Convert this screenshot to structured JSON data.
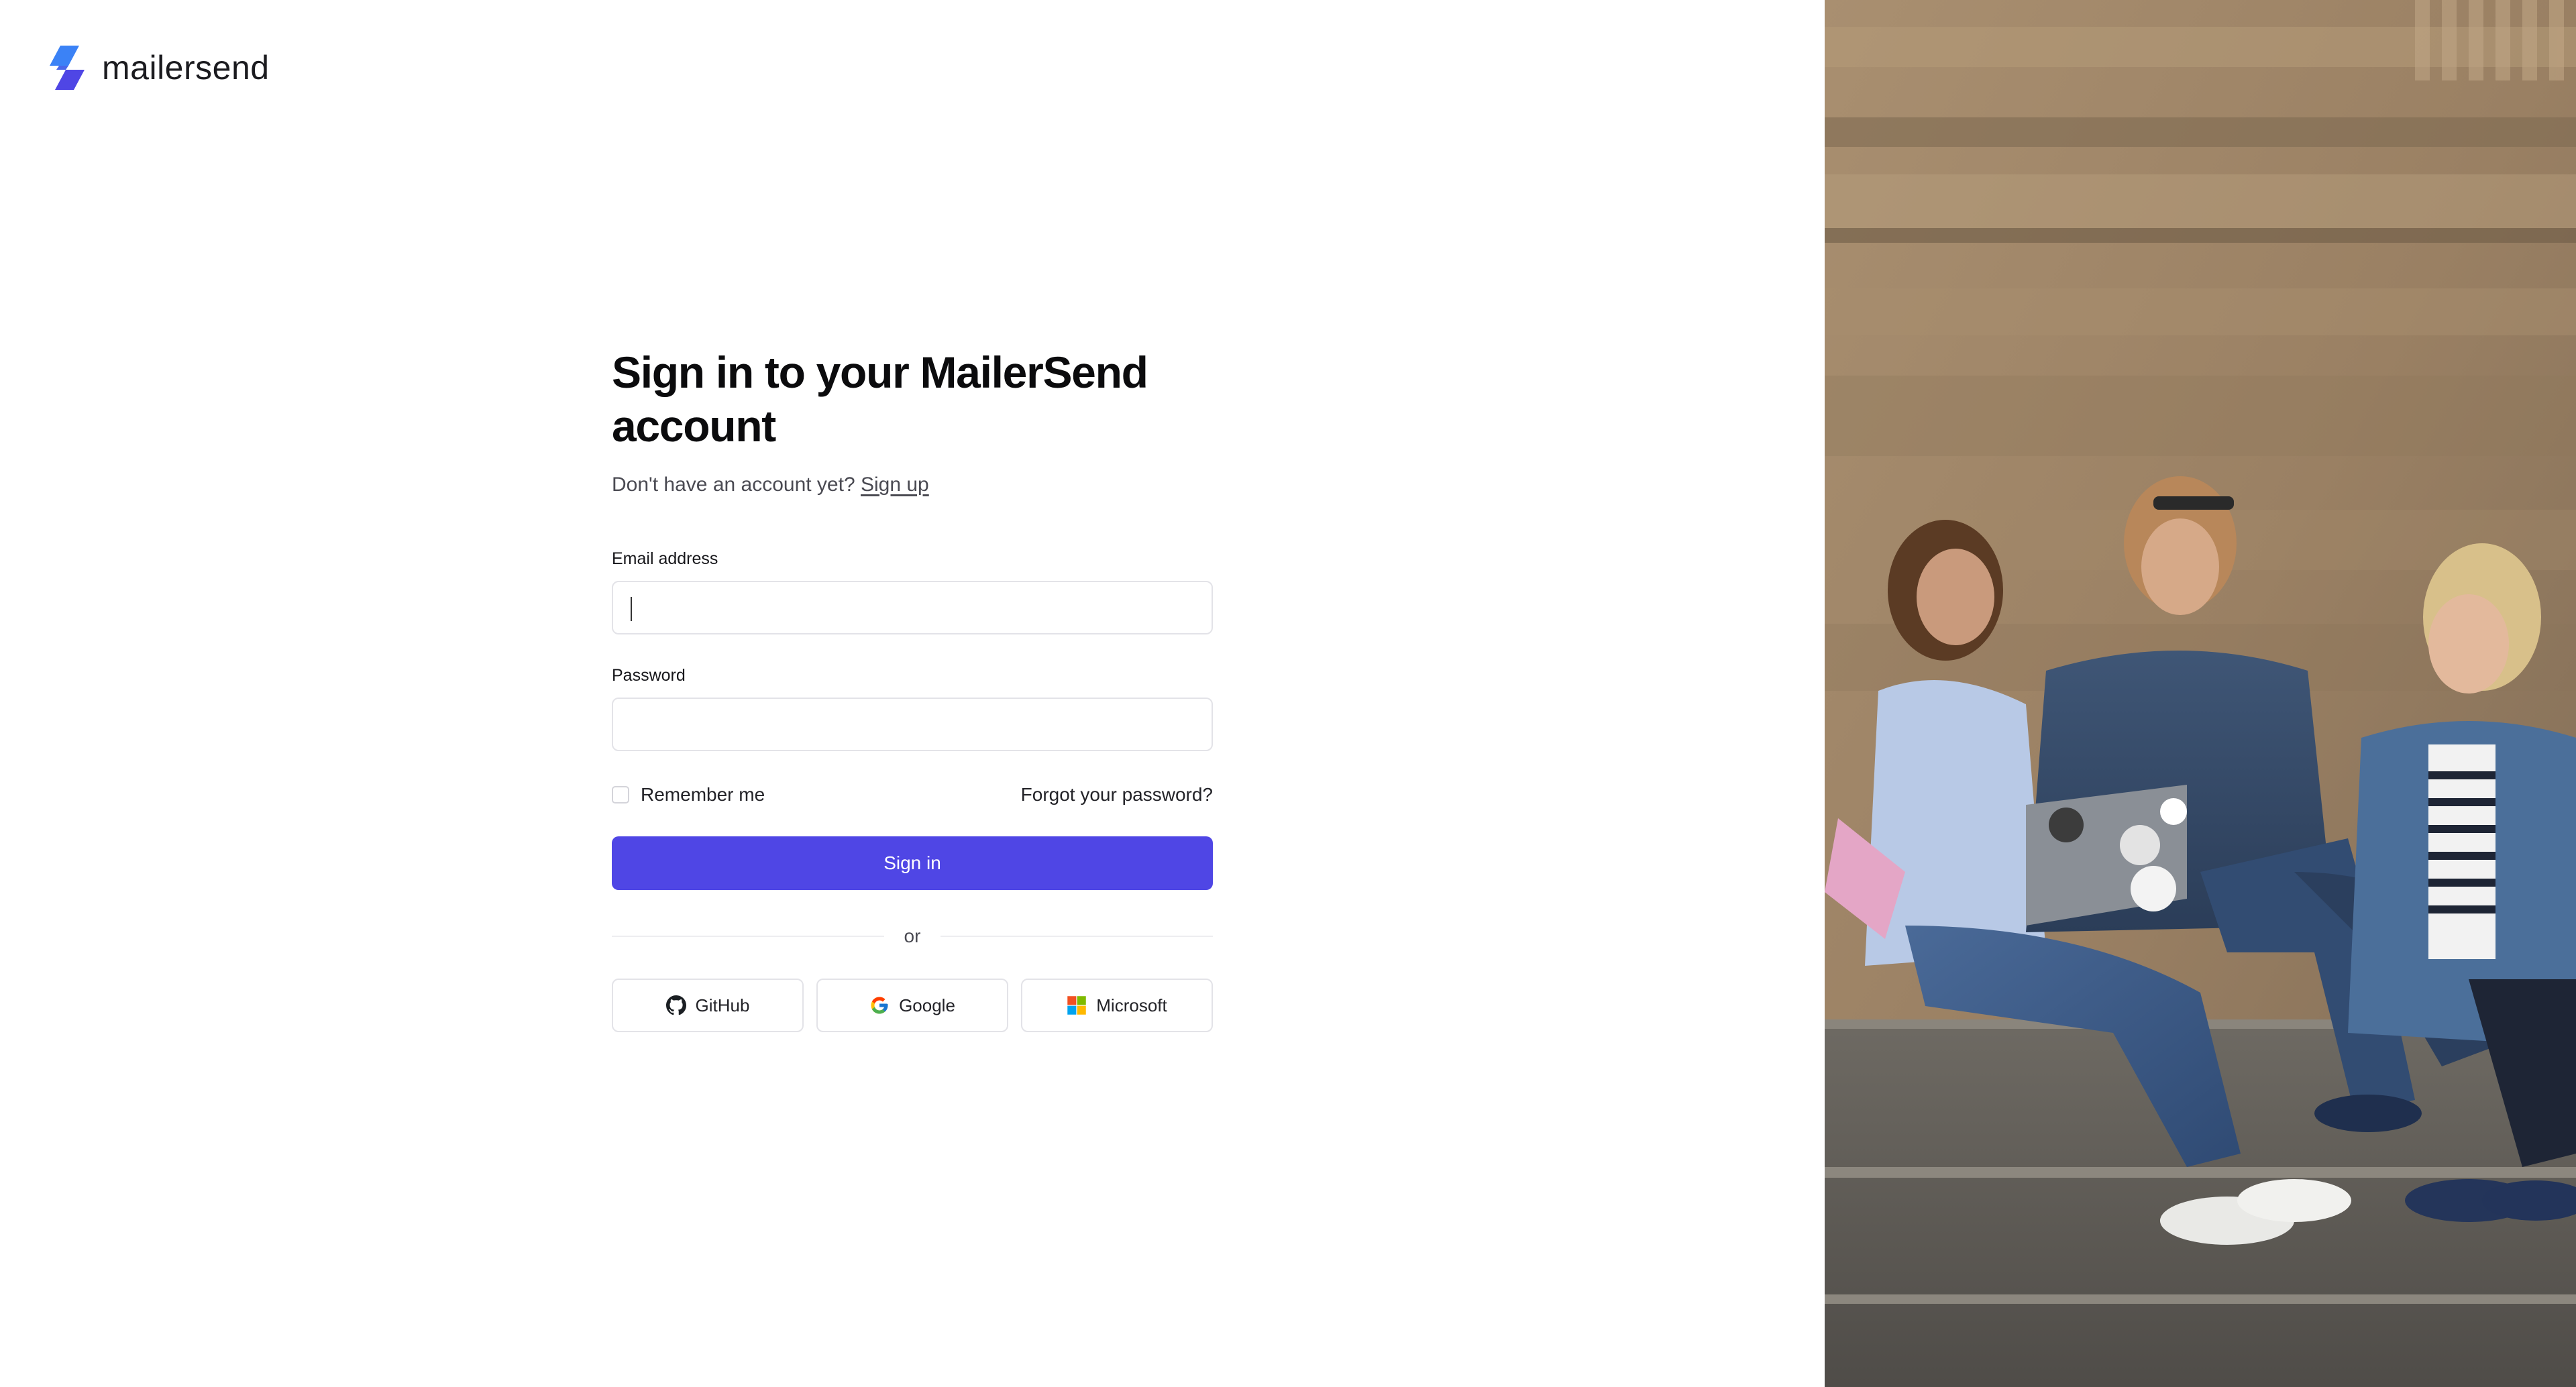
{
  "logo": {
    "wordmark": "mailersend",
    "icon": "mailersend-logo-icon"
  },
  "form": {
    "title": "Sign in to your MailerSend account",
    "subtitle_prefix": "Don't have an account yet?",
    "signup_link": "Sign up",
    "email_label": "Email address",
    "email_value": "",
    "password_label": "Password",
    "password_value": "",
    "remember_label": "Remember me",
    "remember_checked": false,
    "forgot_link": "Forgot your password?",
    "signin_button": "Sign in",
    "divider_text": "or"
  },
  "social_buttons": [
    {
      "label": "GitHub",
      "icon": "github-icon"
    },
    {
      "label": "Google",
      "icon": "google-icon"
    },
    {
      "label": "Microsoft",
      "icon": "microsoft-icon"
    }
  ],
  "hero_image": {
    "icon": "photo-three-women-sitting-on-stone-steps-with-laptop"
  },
  "colors": {
    "primary": "#4f46e5",
    "logo_blue": "#3b82f6",
    "logo_indigo": "#4f46e5",
    "text": "#0f0f12"
  }
}
